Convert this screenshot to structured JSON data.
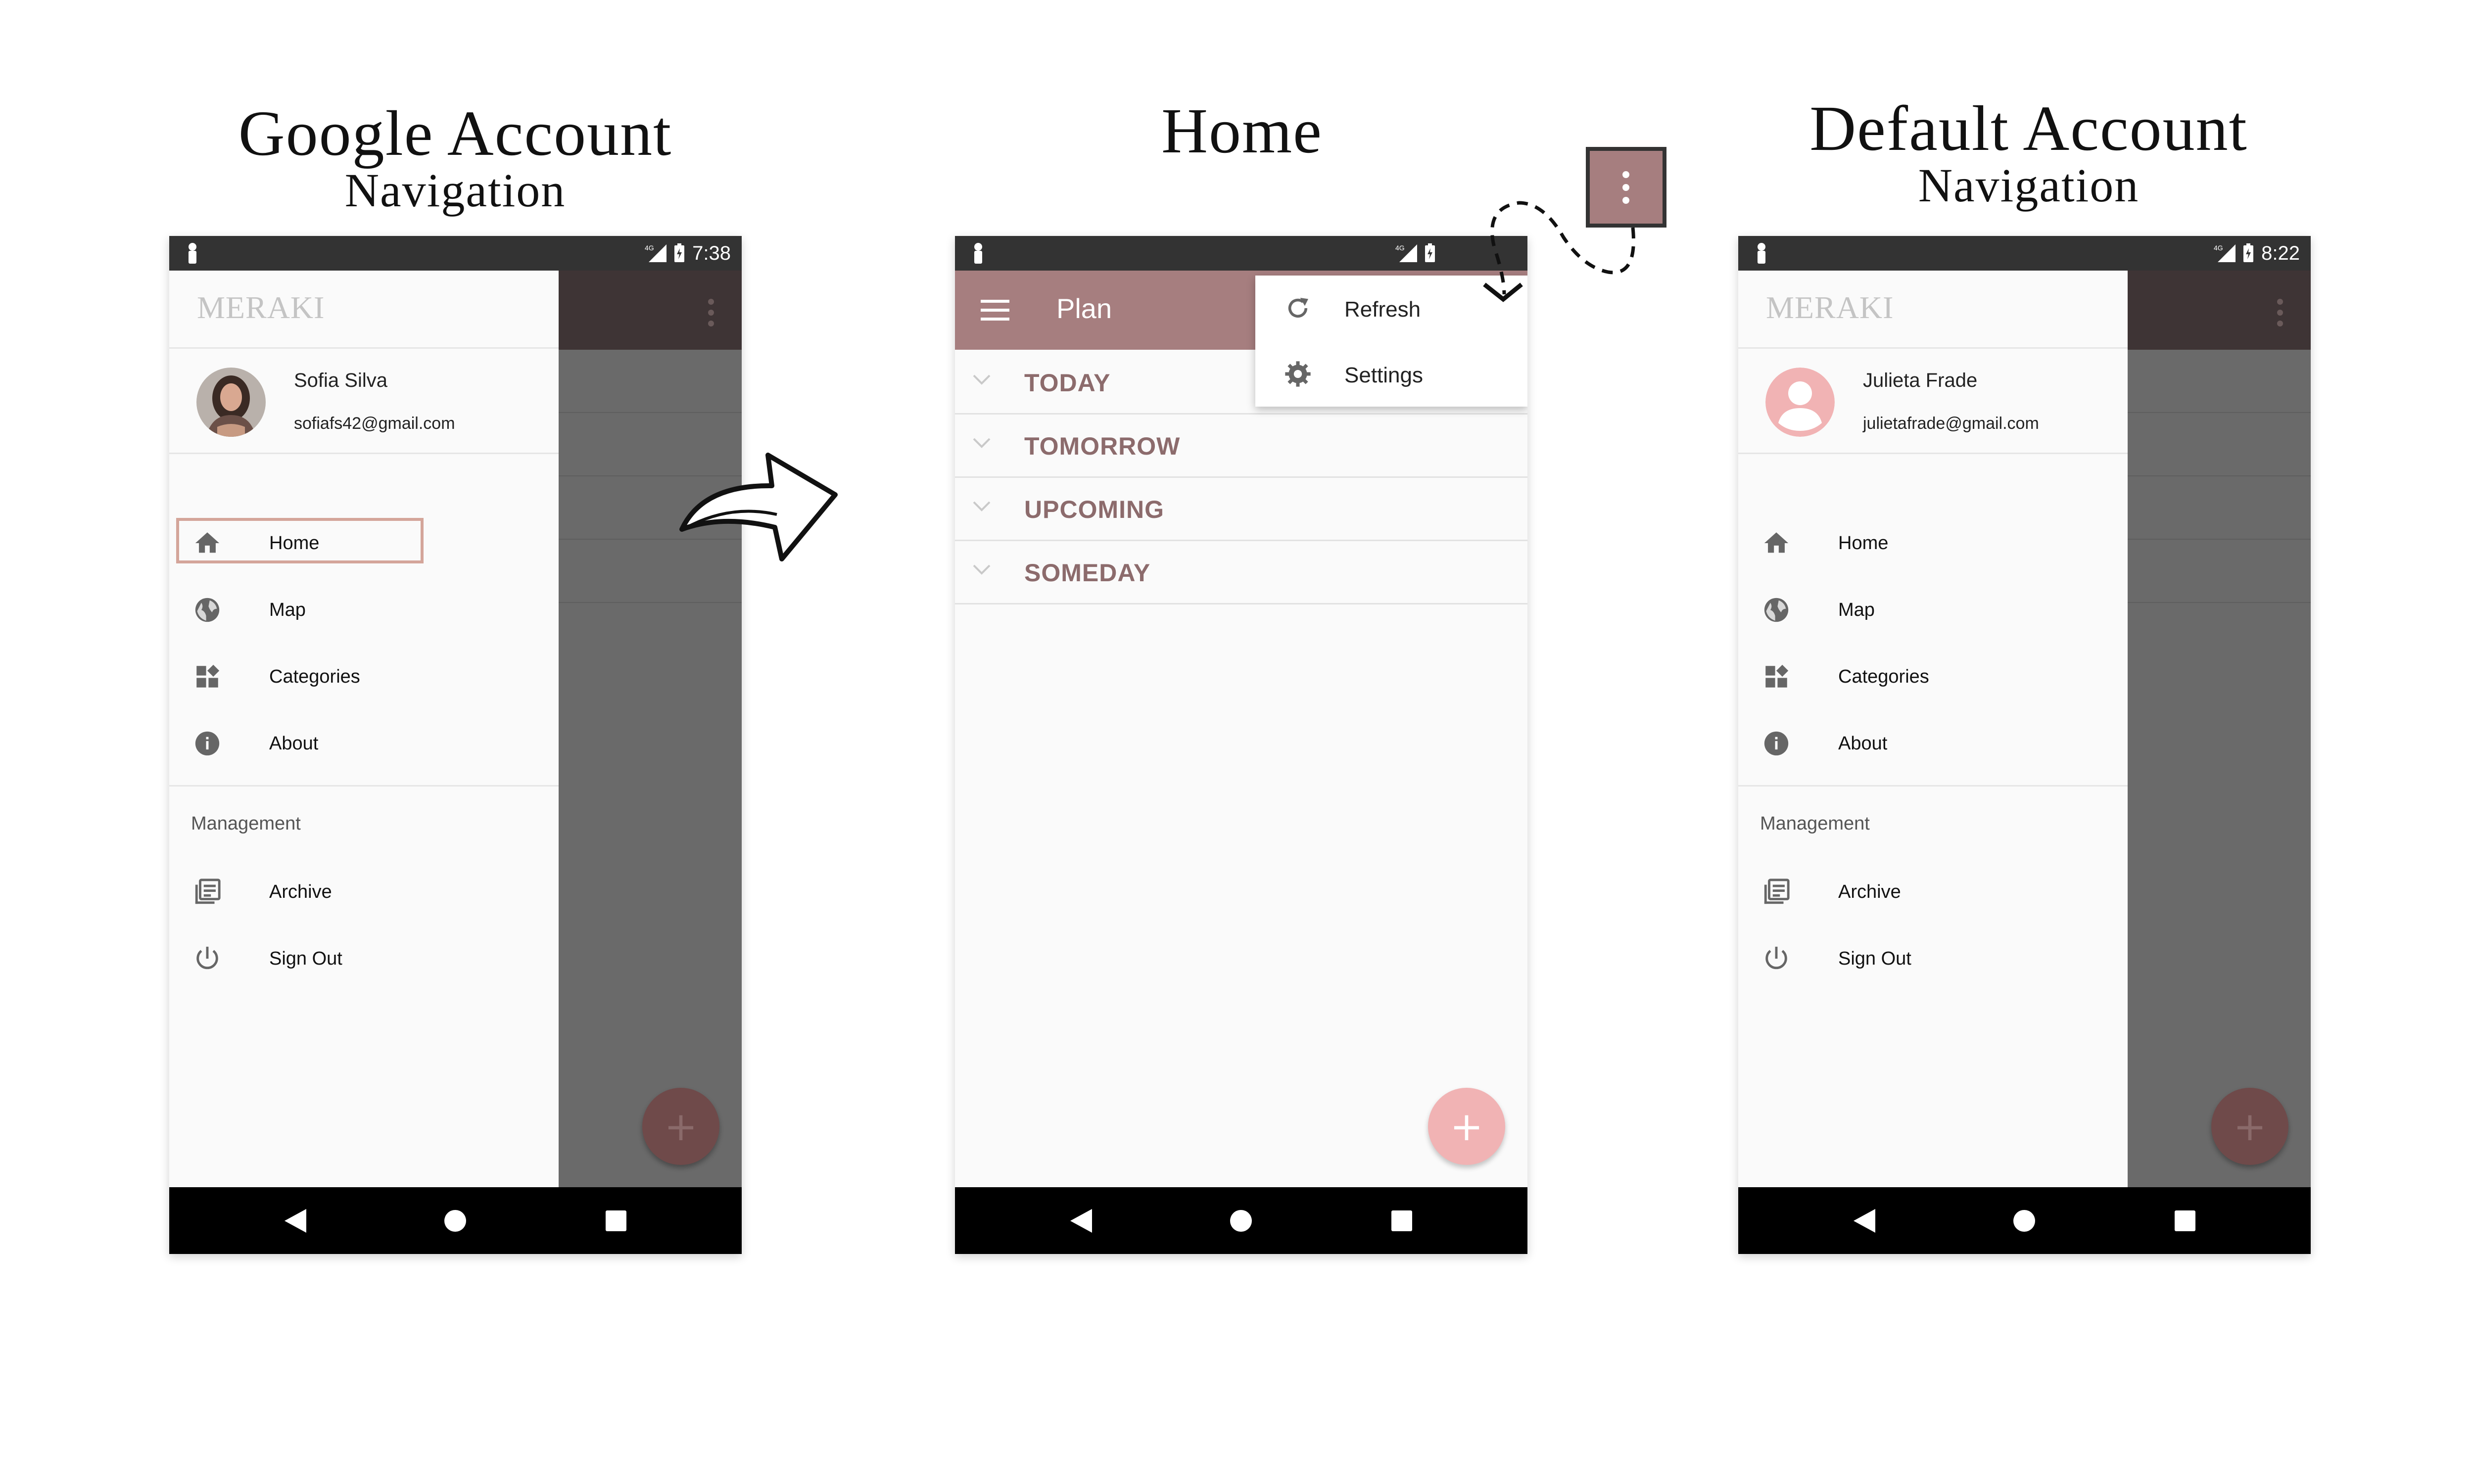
{
  "headings": {
    "left": {
      "title": "Google Account",
      "subtitle": "Navigation"
    },
    "center": {
      "title": "Home"
    },
    "right": {
      "title": "Default Account",
      "subtitle": "Navigation"
    }
  },
  "left_phone": {
    "status_time": "7:38",
    "network": "4G",
    "brand": "MERAKI",
    "user": {
      "name": "Sofia Silva",
      "email": "sofiafs42@gmail.com"
    },
    "menu": [
      {
        "label": "Home",
        "icon": "home-icon"
      },
      {
        "label": "Map",
        "icon": "globe-icon"
      },
      {
        "label": "Categories",
        "icon": "categories-icon"
      },
      {
        "label": "About",
        "icon": "info-icon"
      }
    ],
    "section_label": "Management",
    "management": [
      {
        "label": "Archive",
        "icon": "archive-icon"
      },
      {
        "label": "Sign Out",
        "icon": "power-icon"
      }
    ],
    "fab": "+"
  },
  "center_phone": {
    "network": "4G",
    "app_title": "Plan",
    "sections": [
      "TODAY",
      "TOMORROW",
      "UPCOMING",
      "SOMEDAY"
    ],
    "overflow_menu": [
      {
        "label": "Refresh",
        "icon": "refresh-icon"
      },
      {
        "label": "Settings",
        "icon": "gear-icon"
      }
    ],
    "fab": "+"
  },
  "right_phone": {
    "status_time": "8:22",
    "network": "4G",
    "brand": "MERAKI",
    "user": {
      "name": "Julieta Frade",
      "email": "julietafrade@gmail.com"
    },
    "menu": [
      {
        "label": "Home",
        "icon": "home-icon"
      },
      {
        "label": "Map",
        "icon": "globe-icon"
      },
      {
        "label": "Categories",
        "icon": "categories-icon"
      },
      {
        "label": "About",
        "icon": "info-icon"
      }
    ],
    "section_label": "Management",
    "management": [
      {
        "label": "Archive",
        "icon": "archive-icon"
      },
      {
        "label": "Sign Out",
        "icon": "power-icon"
      }
    ],
    "fab": "+"
  },
  "colors": {
    "accent": "#a67e7f",
    "section_text": "#8c6b6c",
    "fab": "#f1b3b4",
    "highlight": "#d4a59a"
  }
}
